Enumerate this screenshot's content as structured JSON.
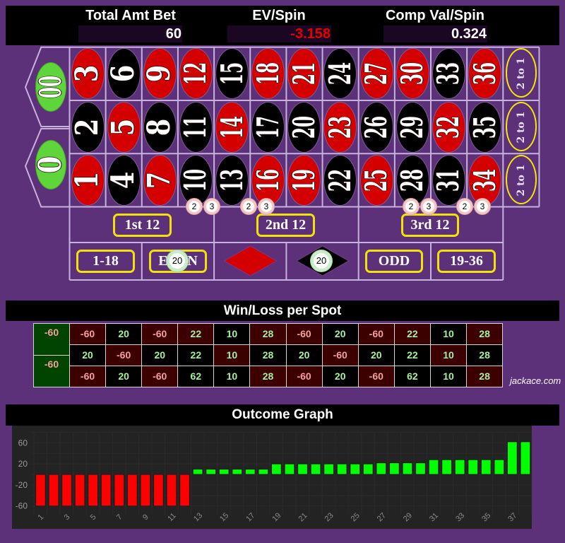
{
  "header": {
    "total_bet": {
      "label": "Total Amt Bet",
      "value": "60"
    },
    "ev_spin": {
      "label": "EV/Spin",
      "value": "-3.158"
    },
    "comp_val": {
      "label": "Comp Val/Spin",
      "value": "0.324"
    }
  },
  "table": {
    "zeros": [
      {
        "label": "00",
        "color": "green"
      },
      {
        "label": "0",
        "color": "green"
      }
    ],
    "rows": [
      [
        {
          "n": "3",
          "color": "red"
        },
        {
          "n": "6",
          "color": "black"
        },
        {
          "n": "9",
          "color": "red"
        },
        {
          "n": "12",
          "color": "red"
        },
        {
          "n": "15",
          "color": "black"
        },
        {
          "n": "18",
          "color": "red"
        },
        {
          "n": "21",
          "color": "red"
        },
        {
          "n": "24",
          "color": "black"
        },
        {
          "n": "27",
          "color": "red"
        },
        {
          "n": "30",
          "color": "red"
        },
        {
          "n": "33",
          "color": "black"
        },
        {
          "n": "36",
          "color": "red"
        }
      ],
      [
        {
          "n": "2",
          "color": "black"
        },
        {
          "n": "5",
          "color": "red"
        },
        {
          "n": "8",
          "color": "black"
        },
        {
          "n": "11",
          "color": "black"
        },
        {
          "n": "14",
          "color": "red"
        },
        {
          "n": "17",
          "color": "black"
        },
        {
          "n": "20",
          "color": "black"
        },
        {
          "n": "23",
          "color": "red"
        },
        {
          "n": "26",
          "color": "black"
        },
        {
          "n": "29",
          "color": "black"
        },
        {
          "n": "32",
          "color": "red"
        },
        {
          "n": "35",
          "color": "black"
        }
      ],
      [
        {
          "n": "1",
          "color": "red"
        },
        {
          "n": "4",
          "color": "black"
        },
        {
          "n": "7",
          "color": "red"
        },
        {
          "n": "10",
          "color": "black"
        },
        {
          "n": "13",
          "color": "black"
        },
        {
          "n": "16",
          "color": "red"
        },
        {
          "n": "19",
          "color": "red"
        },
        {
          "n": "22",
          "color": "black"
        },
        {
          "n": "25",
          "color": "red"
        },
        {
          "n": "28",
          "color": "black"
        },
        {
          "n": "31",
          "color": "black"
        },
        {
          "n": "34",
          "color": "red"
        }
      ]
    ],
    "column_bets": [
      "2 to 1",
      "2 to 1",
      "2 to 1"
    ],
    "dozens": [
      "1st 12",
      "2nd 12",
      "3rd 12"
    ],
    "outside": {
      "low": "1-18",
      "even": "EVEN",
      "red_icon": "red-diamond-icon",
      "black_icon": "black-diamond-icon",
      "odd": "ODD",
      "high": "19-36"
    },
    "chips": {
      "line_bets": [
        "2",
        "3",
        "2",
        "3",
        "2",
        "3",
        "2",
        "3"
      ],
      "even": "20",
      "black": "20"
    }
  },
  "winloss": {
    "title": "Win/Loss per Spot",
    "zeros": [
      "-60",
      "-60"
    ],
    "rows": [
      [
        {
          "v": "-60",
          "bg": "red"
        },
        {
          "v": "20",
          "bg": "black"
        },
        {
          "v": "-60",
          "bg": "red"
        },
        {
          "v": "22",
          "bg": "red"
        },
        {
          "v": "10",
          "bg": "black"
        },
        {
          "v": "28",
          "bg": "red"
        },
        {
          "v": "-60",
          "bg": "red"
        },
        {
          "v": "20",
          "bg": "black"
        },
        {
          "v": "-60",
          "bg": "red"
        },
        {
          "v": "22",
          "bg": "red"
        },
        {
          "v": "10",
          "bg": "black"
        },
        {
          "v": "28",
          "bg": "red"
        }
      ],
      [
        {
          "v": "20",
          "bg": "black"
        },
        {
          "v": "-60",
          "bg": "red"
        },
        {
          "v": "20",
          "bg": "black"
        },
        {
          "v": "22",
          "bg": "black"
        },
        {
          "v": "10",
          "bg": "red"
        },
        {
          "v": "28",
          "bg": "black"
        },
        {
          "v": "20",
          "bg": "black"
        },
        {
          "v": "-60",
          "bg": "red"
        },
        {
          "v": "20",
          "bg": "black"
        },
        {
          "v": "22",
          "bg": "black"
        },
        {
          "v": "10",
          "bg": "red"
        },
        {
          "v": "28",
          "bg": "black"
        }
      ],
      [
        {
          "v": "-60",
          "bg": "red"
        },
        {
          "v": "20",
          "bg": "black"
        },
        {
          "v": "-60",
          "bg": "red"
        },
        {
          "v": "62",
          "bg": "black"
        },
        {
          "v": "10",
          "bg": "black"
        },
        {
          "v": "28",
          "bg": "red"
        },
        {
          "v": "-60",
          "bg": "red"
        },
        {
          "v": "20",
          "bg": "black"
        },
        {
          "v": "-60",
          "bg": "red"
        },
        {
          "v": "62",
          "bg": "black"
        },
        {
          "v": "10",
          "bg": "black"
        },
        {
          "v": "28",
          "bg": "red"
        }
      ]
    ],
    "credit": "jackace.com"
  },
  "outcome": {
    "title": "Outcome Graph"
  },
  "colors": {
    "felt": "#5d3179",
    "red": "#d40000",
    "black": "#000000",
    "green": "#5fd53b",
    "accent_yellow": "#f3e20a",
    "ev_negative": "#e40000",
    "loss_text": "#f4a0a0",
    "win_text": "#a8f0a0"
  },
  "chart_data": {
    "type": "bar",
    "title": "Outcome Graph",
    "xlabel": "",
    "ylabel": "",
    "categories": [
      "1",
      "2",
      "3",
      "4",
      "5",
      "6",
      "7",
      "8",
      "9",
      "10",
      "11",
      "12",
      "13",
      "14",
      "15",
      "16",
      "17",
      "18",
      "19",
      "20",
      "21",
      "22",
      "23",
      "24",
      "25",
      "26",
      "27",
      "28",
      "29",
      "30",
      "31",
      "32",
      "33",
      "34",
      "35",
      "36",
      "37",
      "38"
    ],
    "values": [
      -60,
      -60,
      -60,
      -60,
      -60,
      -60,
      -60,
      -60,
      -60,
      -60,
      -60,
      -60,
      10,
      10,
      10,
      10,
      10,
      10,
      20,
      20,
      20,
      20,
      20,
      20,
      20,
      20,
      22,
      22,
      22,
      22,
      28,
      28,
      28,
      28,
      28,
      28,
      62,
      62
    ],
    "ylim": [
      -68,
      80
    ],
    "yticks": [
      60,
      20,
      -20,
      -60
    ],
    "xticks_shown": [
      "1",
      "3",
      "5",
      "7",
      "9",
      "11",
      "13",
      "15",
      "17",
      "19",
      "21",
      "23",
      "25",
      "27",
      "29",
      "31",
      "33",
      "35",
      "37"
    ],
    "grid": true,
    "legend": "none",
    "colors": {
      "negative": "#ff0000",
      "positive": "#00ff00"
    }
  }
}
